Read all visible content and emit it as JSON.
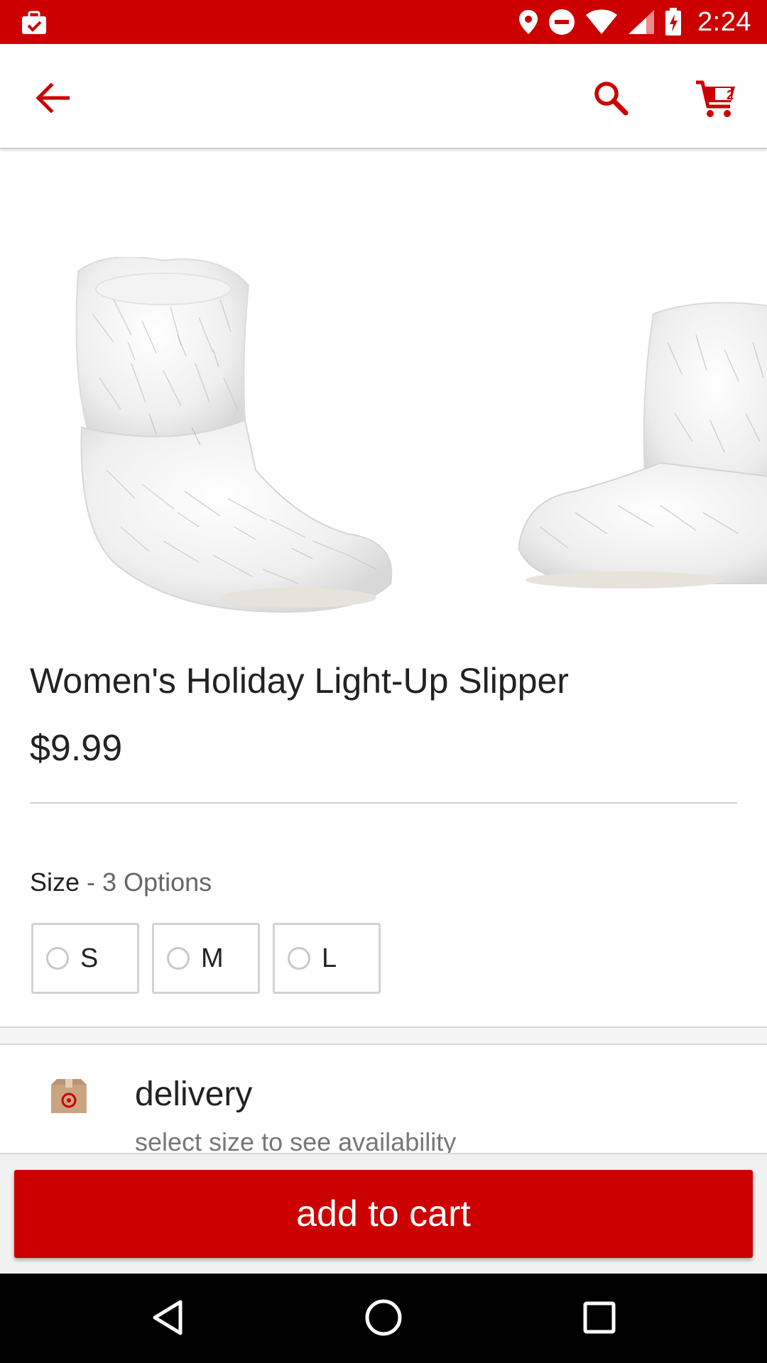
{
  "status_bar": {
    "time": "2:24",
    "icons": [
      "briefcase-check-icon",
      "location-icon",
      "do-not-disturb-icon",
      "wifi-icon",
      "cell-signal-icon",
      "battery-charging-icon"
    ]
  },
  "app_bar": {
    "back_icon": "arrow-back-icon",
    "search_icon": "search-icon",
    "cart_icon": "cart-icon",
    "cart_count": "2"
  },
  "colors": {
    "brand": "#cc0000",
    "text": "#222222",
    "muted": "#777777"
  },
  "product": {
    "images": [
      "white-faux-fur-slipper-boot",
      "white-faux-fur-slipper-boot-side"
    ],
    "title": "Women's Holiday Light-Up Slipper",
    "price": "$9.99"
  },
  "size": {
    "label": "Size",
    "options_text": " - 3 Options",
    "options": [
      "S",
      "M",
      "L"
    ]
  },
  "delivery": {
    "icon": "target-box-icon",
    "title": "delivery",
    "subtitle": "select size to see availability"
  },
  "actions": {
    "add_to_cart": "add to cart"
  },
  "nav_bar": {
    "icons": [
      "back-triangle-icon",
      "home-circle-icon",
      "recents-square-icon"
    ]
  }
}
